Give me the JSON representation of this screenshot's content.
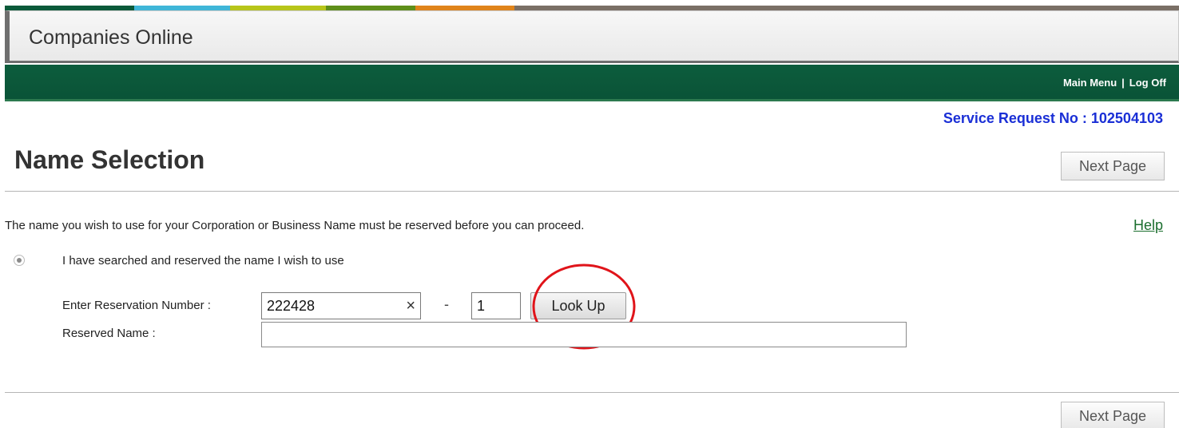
{
  "header": {
    "app_title": "Companies Online",
    "color_stripes": [
      "#0b5a3a",
      "#3fb6d8",
      "#b7c51a",
      "#5e8f1a",
      "#e0841b",
      "#7a6f66"
    ]
  },
  "nav": {
    "main_menu": "Main Menu",
    "separator": "|",
    "log_off": "Log Off"
  },
  "service_request": {
    "label": "Service Request No : 102504103"
  },
  "page": {
    "title": "Name Selection",
    "next_page_label": "Next Page",
    "intro_text": "The name you wish to use for your Corporation or Business Name must be reserved before you can proceed.",
    "help_label": "Help"
  },
  "form": {
    "radio_label": "I have searched and reserved the name I wish to use",
    "reservation_number_label": "Enter Reservation Number :",
    "reservation_number_value": "222428",
    "clear_glyph": "×",
    "dash": "-",
    "suffix_value": "1",
    "lookup_label": "Look Up",
    "reserved_name_label": "Reserved Name :",
    "reserved_name_value": ""
  },
  "colors": {
    "nav_green": "#0a5337",
    "service_request_blue": "#1a2fd6",
    "help_green": "#1b6e2e",
    "annotation_red": "#e0141a"
  }
}
